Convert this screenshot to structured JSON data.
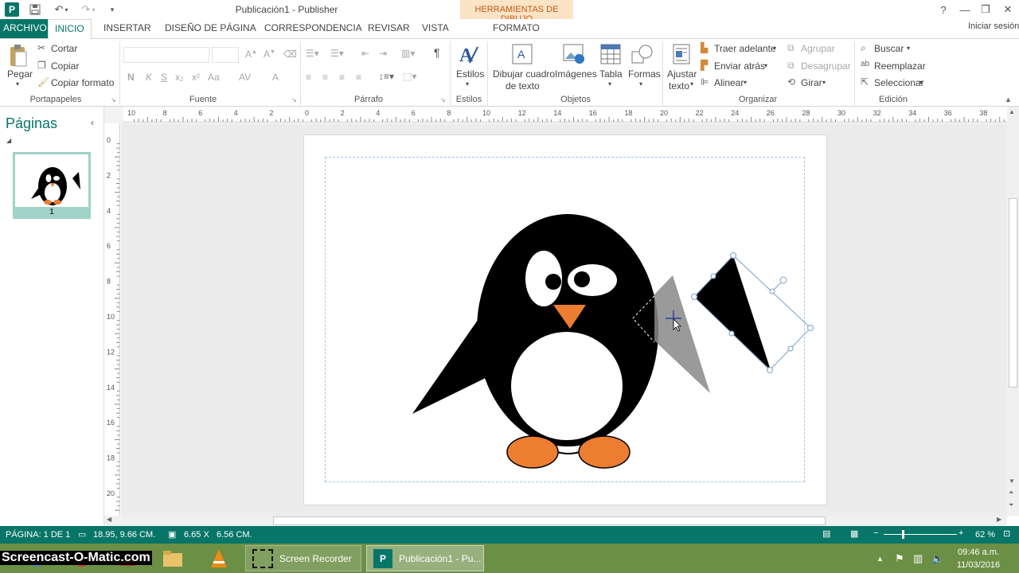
{
  "window": {
    "app_icon_letter": "P",
    "title": "Publicación1 - Publisher",
    "contextual_tools": "HERRAMIENTAS DE DIBUJO",
    "controls": {
      "help": "?",
      "minimize": "—",
      "restore": "❐",
      "close": "✕"
    },
    "signin": "Iniciar sesión"
  },
  "tabs": [
    "ARCHIVO",
    "INICIO",
    "INSERTAR",
    "DISEÑO DE PÁGINA",
    "CORRESPONDENCIA",
    "REVISAR",
    "VISTA",
    "FORMATO"
  ],
  "ribbon": {
    "clipboard": {
      "paste": "Pegar",
      "cut": "Cortar",
      "copy": "Copiar",
      "format_painter": "Copiar formato",
      "label": "Portapapeles"
    },
    "font": {
      "label": "Fuente",
      "bold": "N",
      "italic": "K",
      "underline": "S",
      "subscript": "x₂",
      "superscript": "x²",
      "case": "Aa",
      "spacing": "AV",
      "color": "A"
    },
    "paragraph": {
      "label": "Párrafo",
      "pilcrow": "¶"
    },
    "styles": {
      "button": "Estilos",
      "label": "Estilos"
    },
    "objects": {
      "draw_textbox": "Dibujar cuadro",
      "draw_textbox_2": "de texto",
      "images": "Imágenes",
      "table": "Tabla",
      "shapes": "Formas",
      "label": "Objetos"
    },
    "arrange": {
      "wrap_text": "Ajustar",
      "wrap_text_2": "texto",
      "bring_forward": "Traer adelante",
      "send_backward": "Enviar atrás",
      "align": "Alinear",
      "group": "Agrupar",
      "ungroup": "Desagrupar",
      "rotate": "Girar",
      "label": "Organizar"
    },
    "editing": {
      "find": "Buscar",
      "replace": "Reemplazar",
      "select": "Seleccionar",
      "label": "Edición"
    }
  },
  "pages_pane": {
    "title": "Páginas",
    "page_number": "1"
  },
  "ruler": {
    "h_labels": [
      "10",
      "8",
      "6",
      "4",
      "2",
      "0",
      "2",
      "4",
      "6",
      "8",
      "10",
      "12",
      "14",
      "16",
      "18",
      "20",
      "22",
      "24",
      "26",
      "28",
      "30",
      "32",
      "34",
      "36",
      "38"
    ],
    "v_labels": [
      "0",
      "2",
      "4",
      "6",
      "8",
      "10",
      "12",
      "14",
      "16",
      "18",
      "20"
    ]
  },
  "status": {
    "page": "PÁGINA: 1 DE 1",
    "position": "18.95, 9.66 CM.",
    "size": "6.65 X   6.56 CM.",
    "zoom": "62 %"
  },
  "taskbar": {
    "watermark": "Screencast-O-Matic.com",
    "screen_recorder": "Screen Recorder",
    "publisher_task": "Publicación1 - Pu...",
    "time": "09:46 a.m.",
    "date": "11/03/2016"
  },
  "colors": {
    "accent": "#077568",
    "tools_tab": "#fbe3c6",
    "beak_feet": "#ed7d31"
  }
}
